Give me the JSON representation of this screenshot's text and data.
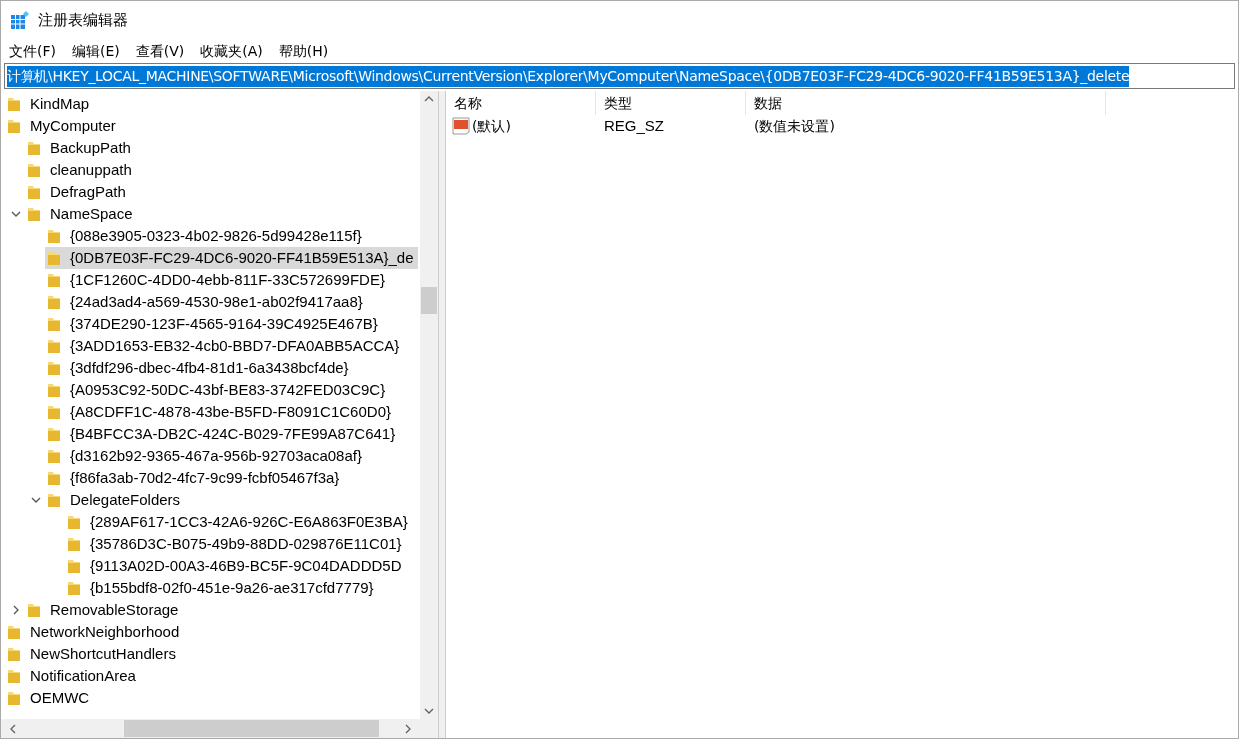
{
  "window": {
    "title": "注册表编辑器"
  },
  "menu": [
    "文件(F)",
    "编辑(E)",
    "查看(V)",
    "收藏夹(A)",
    "帮助(H)"
  ],
  "address": {
    "value": "计算机\\HKEY_LOCAL_MACHINE\\SOFTWARE\\Microsoft\\Windows\\CurrentVersion\\Explorer\\MyComputer\\NameSpace\\{0DB7E03F-FC29-4DC6-9020-FF41B59E513A}_delete"
  },
  "tree": [
    {
      "label": "KindMap",
      "selected": false
    },
    {
      "label": "MyComputer",
      "selected": false,
      "children": [
        {
          "label": "BackupPath",
          "selected": false
        },
        {
          "label": "cleanuppath",
          "selected": false
        },
        {
          "label": "DefragPath",
          "selected": false
        },
        {
          "label": "NameSpace",
          "selected": false,
          "expanded": true,
          "children": [
            {
              "label": "{088e3905-0323-4b02-9826-5d99428e115f}",
              "selected": false
            },
            {
              "label": "{0DB7E03F-FC29-4DC6-9020-FF41B59E513A}_de",
              "selected": true
            },
            {
              "label": "{1CF1260C-4DD0-4ebb-811F-33C572699FDE}",
              "selected": false
            },
            {
              "label": "{24ad3ad4-a569-4530-98e1-ab02f9417aa8}",
              "selected": false
            },
            {
              "label": "{374DE290-123F-4565-9164-39C4925E467B}",
              "selected": false
            },
            {
              "label": "{3ADD1653-EB32-4cb0-BBD7-DFA0ABB5ACCA}",
              "selected": false
            },
            {
              "label": "{3dfdf296-dbec-4fb4-81d1-6a3438bcf4de}",
              "selected": false
            },
            {
              "label": "{A0953C92-50DC-43bf-BE83-3742FED03C9C}",
              "selected": false
            },
            {
              "label": "{A8CDFF1C-4878-43be-B5FD-F8091C1C60D0}",
              "selected": false
            },
            {
              "label": "{B4BFCC3A-DB2C-424C-B029-7FE99A87C641}",
              "selected": false
            },
            {
              "label": "{d3162b92-9365-467a-956b-92703aca08af}",
              "selected": false
            },
            {
              "label": "{f86fa3ab-70d2-4fc7-9c99-fcbf05467f3a}",
              "selected": false
            },
            {
              "label": "DelegateFolders",
              "selected": false,
              "expanded": true,
              "children": [
                {
                  "label": "{289AF617-1CC3-42A6-926C-E6A863F0E3BA}",
                  "selected": false
                },
                {
                  "label": "{35786D3C-B075-49b9-88DD-029876E11C01}",
                  "selected": false
                },
                {
                  "label": "{9113A02D-00A3-46B9-BC5F-9C04DADDD5D",
                  "selected": false
                },
                {
                  "label": "{b155bdf8-02f0-451e-9a26-ae317cfd7779}",
                  "selected": false
                }
              ]
            }
          ]
        },
        {
          "label": "RemovableStorage",
          "selected": false,
          "expanded": false
        }
      ]
    },
    {
      "label": "NetworkNeighborhood",
      "selected": false
    },
    {
      "label": "NewShortcutHandlers",
      "selected": false
    },
    {
      "label": "NotificationArea",
      "selected": false
    },
    {
      "label": "OEMWC",
      "selected": false
    }
  ],
  "values": {
    "columns": [
      "名称",
      "类型",
      "数据"
    ],
    "rows": [
      {
        "name": "(默认)",
        "type": "REG_SZ",
        "data": "(数值未设置)"
      }
    ]
  }
}
